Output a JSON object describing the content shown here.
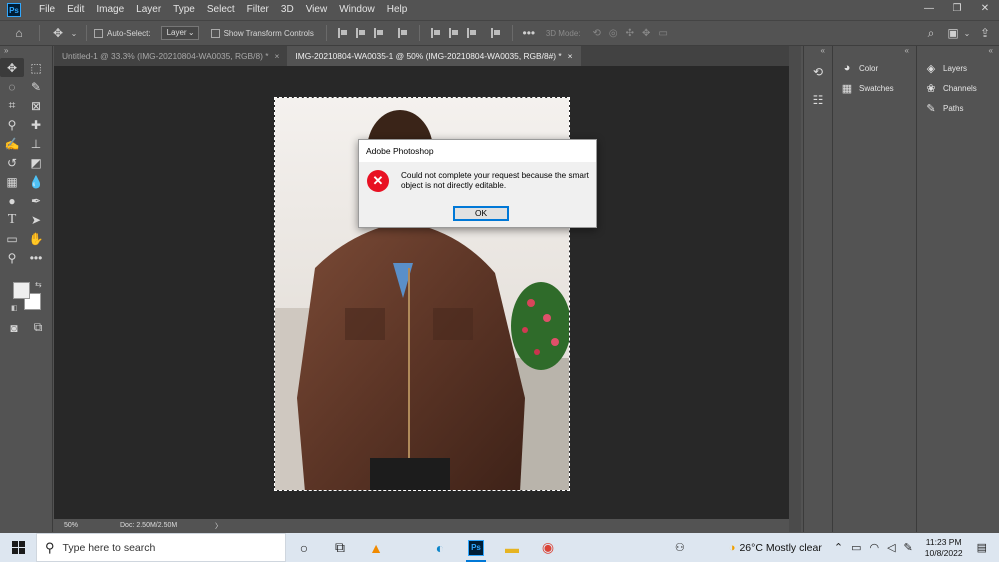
{
  "app": {
    "logo_text": "Ps",
    "name": "Adobe Photoshop"
  },
  "menu": [
    "File",
    "Edit",
    "Image",
    "Layer",
    "Type",
    "Select",
    "Filter",
    "3D",
    "View",
    "Window",
    "Help"
  ],
  "window_controls": {
    "minimize": "—",
    "restore": "❐",
    "close": "✕"
  },
  "options_bar": {
    "auto_select_label": "Auto-Select:",
    "auto_select_value": "Layer",
    "show_transform_label": "Show Transform Controls",
    "mode_3d_label": "3D Mode:"
  },
  "tabs": [
    {
      "label": "Untitled-1 @ 33.3% (IMG-20210804-WA0035, RGB/8) *",
      "close": "×"
    },
    {
      "label": "IMG-20210804-WA0035-1 @ 50% (IMG-20210804-WA0035, RGB/8#) *",
      "close": "×"
    }
  ],
  "status_bar": {
    "zoom": "50%",
    "doc": "Doc: 2.50M/2.50M",
    "arrow": "〉"
  },
  "panels": {
    "left_group": [
      {
        "label": "Color",
        "icon": "color-wheel-icon"
      },
      {
        "label": "Swatches",
        "icon": "grid-icon"
      }
    ],
    "right_group": [
      {
        "label": "Layers",
        "icon": "layers-icon"
      },
      {
        "label": "Channels",
        "icon": "channels-icon"
      },
      {
        "label": "Paths",
        "icon": "paths-icon"
      }
    ]
  },
  "dialog": {
    "title": "Adobe Photoshop",
    "message": "Could not complete your request because the smart object is not directly editable.",
    "ok_label": "OK"
  },
  "taskbar": {
    "search_placeholder": "Type here to search",
    "weather": "26°C  Mostly clear",
    "time": "11:23 PM",
    "date": "10/8/2022"
  },
  "colors": {
    "accent": "#0078d7",
    "error": "#e81123",
    "ps_blue": "#31a8ff",
    "ui_gray": "#535353",
    "canvas_dark": "#282828"
  }
}
